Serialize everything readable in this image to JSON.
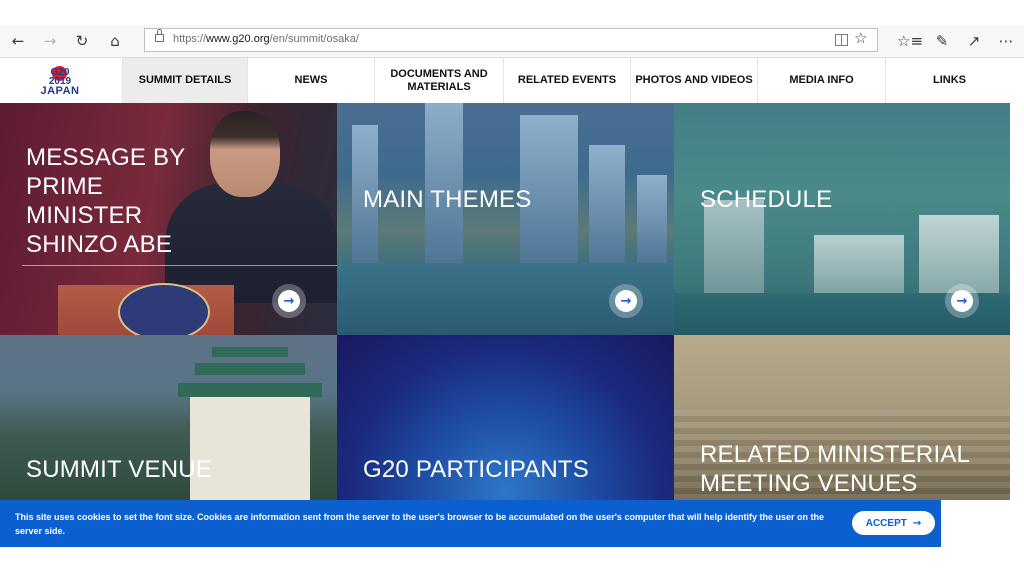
{
  "browser": {
    "url_prefix": "https://",
    "url_host": "www.g20.org",
    "url_path": "/en/summit/osaka/",
    "icons": [
      "back-arrow-icon",
      "forward-arrow-icon",
      "refresh-icon",
      "home-icon",
      "lock-icon",
      "reading-view-icon",
      "favorite-star-icon",
      "favorites-list-icon",
      "pen-icon",
      "share-icon",
      "more-icon"
    ]
  },
  "logo": {
    "line1": "G20",
    "line2": "2019",
    "line3": "JAPAN"
  },
  "nav": {
    "items": [
      {
        "label": "SUMMIT DETAILS"
      },
      {
        "label": "NEWS"
      },
      {
        "label": "DOCUMENTS AND MATERIALS"
      },
      {
        "label": "RELATED EVENTS"
      },
      {
        "label": "PHOTOS AND VIDEOS"
      },
      {
        "label": "MEDIA INFO"
      },
      {
        "label": "LINKS"
      }
    ]
  },
  "tiles": {
    "message": {
      "title": "MESSAGE BY PRIME MINISTER SHINZO ABE"
    },
    "themes": {
      "title": "MAIN THEMES"
    },
    "schedule": {
      "title": "SCHEDULE"
    },
    "venue": {
      "title": "SUMMIT VENUE"
    },
    "participants": {
      "title": "G20 PARTICIPANTS"
    },
    "ministerial": {
      "title": "RELATED MINISTERIAL MEETING VENUES"
    }
  },
  "cookie": {
    "text": "This site uses cookies to set the font size. Cookies are information sent from the server to the user's browser to be accumulated on the user's computer that will help identify the user on the server side.",
    "accept_label": "ACCEPT"
  },
  "colors": {
    "accent": "#0b5fcf",
    "logo_blue": "#1e3a8c",
    "logo_red": "#d61f26"
  }
}
